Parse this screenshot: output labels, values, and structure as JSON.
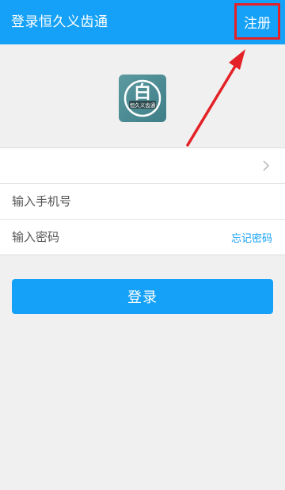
{
  "header": {
    "title": "登录恒久义齿通",
    "register_label": "注册"
  },
  "logo": {
    "glyph": "白",
    "caption": "恒久义齿通"
  },
  "form": {
    "phone_placeholder": "输入手机号",
    "password_placeholder": "输入密码",
    "forgot_label": "忘记密码"
  },
  "login": {
    "label": "登录"
  },
  "colors": {
    "primary": "#14a1f7",
    "annotation": "#e32127",
    "background": "#f0f0f0"
  },
  "icons": {
    "row_chevron": "chevron-right-icon",
    "annotation": "arrow-annotation-icon"
  }
}
